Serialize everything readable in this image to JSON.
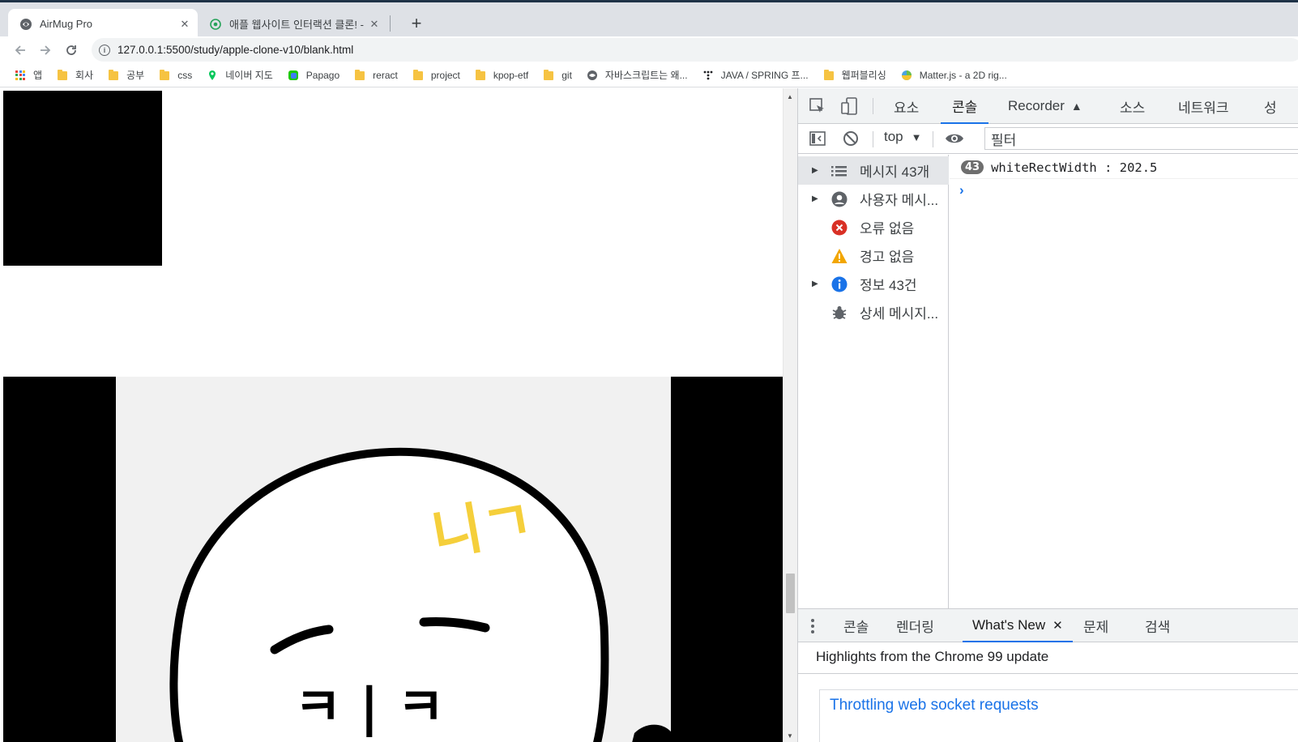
{
  "browser": {
    "tabs": [
      {
        "title": "AirMug Pro",
        "active": true
      },
      {
        "title": "애플 웹사이트 인터랙션 클론! -",
        "active": false
      }
    ],
    "new_tab_symbol": "+",
    "close_symbol": "✕",
    "url": "127.0.0.1:5500/study/apple-clone-v10/blank.html"
  },
  "bookmarks": [
    {
      "label": "앱",
      "icon": "apps-grid-icon"
    },
    {
      "label": "회사",
      "icon": "folder-icon"
    },
    {
      "label": "공부",
      "icon": "folder-icon"
    },
    {
      "label": "css",
      "icon": "folder-icon"
    },
    {
      "label": "네이버 지도",
      "icon": "naver-map-icon"
    },
    {
      "label": "Papago",
      "icon": "papago-icon"
    },
    {
      "label": "reract",
      "icon": "folder-icon"
    },
    {
      "label": "project",
      "icon": "folder-icon"
    },
    {
      "label": "kpop-etf",
      "icon": "folder-icon"
    },
    {
      "label": "git",
      "icon": "folder-icon"
    },
    {
      "label": "자바스크립트는 왜...",
      "icon": "globe-icon"
    },
    {
      "label": "JAVA / SPRING 프...",
      "icon": "dots-icon"
    },
    {
      "label": "웹퍼블리싱",
      "icon": "folder-icon"
    },
    {
      "label": "Matter.js - a 2D rig...",
      "icon": "matter-icon"
    }
  ],
  "page": {
    "drawing_text": "니ㄱ",
    "face_letters": "ㅋ | ㅋ"
  },
  "devtools": {
    "tabs": [
      "요소",
      "콘솔",
      "Recorder",
      "소스",
      "네트워크",
      "성"
    ],
    "active_tab": "콘솔",
    "context": "top",
    "filter_placeholder": "필터",
    "sidebar": [
      {
        "label": "메시지 43개",
        "icon": "list-icon",
        "expandable": true,
        "selected": true
      },
      {
        "label": "사용자 메시...",
        "icon": "user-icon",
        "expandable": true,
        "selected": false
      },
      {
        "label": "오류 없음",
        "icon": "error-icon",
        "expandable": false,
        "selected": false
      },
      {
        "label": "경고 없음",
        "icon": "warning-icon",
        "expandable": false,
        "selected": false
      },
      {
        "label": "정보 43건",
        "icon": "info-icon",
        "expandable": true,
        "selected": false
      },
      {
        "label": "상세 메시지...",
        "icon": "bug-icon",
        "expandable": false,
        "selected": false
      }
    ],
    "log": {
      "count": "43",
      "text": "whiteRectWidth : 202.5"
    },
    "prompt_symbol": "›",
    "drawer_tabs": [
      "콘솔",
      "렌더링",
      "What's New",
      "문제",
      "검색"
    ],
    "drawer_active": "What's New",
    "highlights": "Highlights from the Chrome 99 update",
    "card_title": "Throttling web socket requests"
  },
  "colors": {
    "accent": "#1a73e8",
    "error": "#d93025",
    "warning": "#f2a600",
    "info": "#1a73e8",
    "doodle_yellow": "#f5cf3b"
  }
}
